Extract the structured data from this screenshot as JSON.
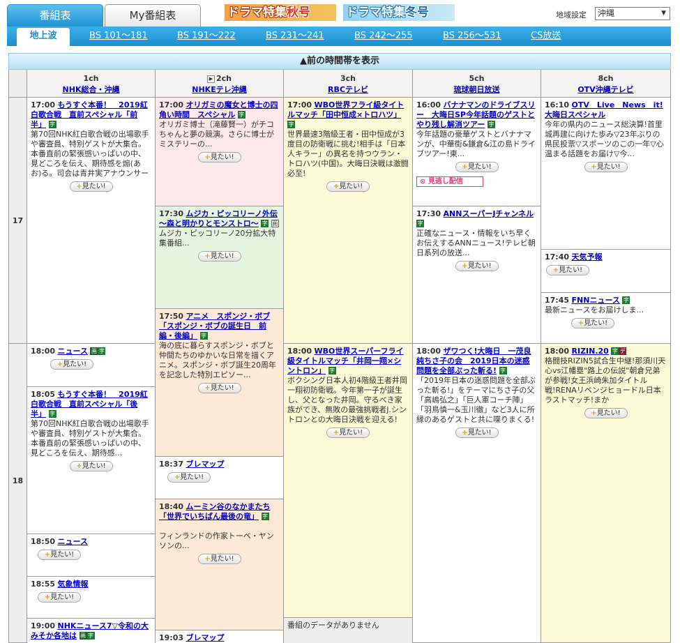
{
  "tabs": {
    "program_guide": "番組表",
    "my_guide": "My番組表"
  },
  "banners": {
    "aki": {
      "prefix": "ドラマ特集",
      "accent": "秋号"
    },
    "fuyu": {
      "prefix": "ドラマ特集",
      "accent": "冬号"
    }
  },
  "region": {
    "label": "地域設定",
    "value": "沖縄"
  },
  "bands": [
    "地上波",
    "BS 101～181",
    "BS 191～222",
    "BS 231～241",
    "BS 242～255",
    "BS 256～531",
    "CS放送"
  ],
  "prev_label": "▲前の時間帯を表示",
  "want_label": "見たい!",
  "miss_label": "見逃し配信",
  "hours": [
    "17",
    "18"
  ],
  "channels": [
    {
      "num": "1ch",
      "name": "NHK総合・沖縄"
    },
    {
      "num": "2ch",
      "name": "NHKEテレ沖縄",
      "play": "▶"
    },
    {
      "num": "3ch",
      "name": "RBCテレビ"
    },
    {
      "num": "5ch",
      "name": "琉球朝日放送"
    },
    {
      "num": "8ch",
      "name": "OTV沖縄テレビ"
    }
  ],
  "programs": {
    "c1p1": {
      "time": "17:00",
      "title": "もうすぐ本番！　2019紅白歌合戦　直前スペシャル「前半」",
      "desc": "第70回NHK紅白歌合戦の出場歌手や審査員、特別ゲストが大集合。本番直前の緊張感いっぱいの中、見どころを伝え、期待感を煽(あお)る。司会は青井実アナウンサー"
    },
    "c1p2": {
      "time": "18:00",
      "title": "ニュース",
      "desc": ""
    },
    "c1p3": {
      "time": "18:05",
      "title": "もうすぐ本番！　2019紅白歌合戦　直前スペシャル「後半」",
      "desc": "第70回NHK紅白歌合戦の出場歌手や審査員、特別ゲストが大集合。本番直前の緊張感いっぱいの中、見どころを伝え、期待感..."
    },
    "c1p4": {
      "time": "18:50",
      "title": "ニュース",
      "desc": ""
    },
    "c1p5": {
      "time": "18:55",
      "title": "気象情報",
      "desc": ""
    },
    "c1p6": {
      "time": "19:00",
      "title": "NHKニュース7▽令和の大みそか各地は",
      "desc": ""
    },
    "c2p1": {
      "time": "17:00",
      "title": "オリガミの魔女と博士の四角い時間　スペシャル",
      "desc": "オリガミ博士（滝藤賢一）がチコちゃんと夢の競演。さらに博士がミステリーの..."
    },
    "c2p2": {
      "time": "17:30",
      "title": "ムジカ・ピッコリーノ外伝～森と明かりとモンストロ～",
      "desc": "ムジカ・ピッコリーノ20分拡大特集番組..."
    },
    "c2p3": {
      "time": "17:50",
      "title": "アニメ　スポンジ・ボブ「スポンジ・ボブの誕生日　前編・後編」",
      "desc": "海の底に暮らすスポンジ・ボブと仲間たちのゆかいな日常を描くアニメ。スポンジ・ボブ誕生20周年を記念した特別エピソー..."
    },
    "c2p4": {
      "time": "18:37",
      "title": "ブレマップ",
      "desc": ""
    },
    "c2p5": {
      "time": "18:40",
      "title": "ムーミン谷のなかまたち「世界でいちばん最後の竜」",
      "desc": "フィンランドの作家トーベ・ヤンソンの..."
    },
    "c2p6": {
      "time": "19:03",
      "title": "ブレマップ",
      "desc": ""
    },
    "c3p1": {
      "time": "17:00",
      "title": "WBO世界フライ級タイトルマッチ「田中恒成×トロハツ」",
      "desc": "世界最速3階級王者・田中恒成が3度目の防衛戦に挑む!相手は「日本人キラー」の異名を持つウラン・トロハツ(中国)。大晦日決戦は激闘必至!"
    },
    "c3p2": {
      "time": "18:00",
      "title": "WBO世界スーパーフライ級タイトルマッチ「井岡一翔×シントロン」",
      "desc": "ボクシング日本人初4階級王者井岡一翔初防衛戦。今年第一子が誕生し、父となった井岡。守るべき家族ができ、無敗の最強挑戦者J.シントロンとの大晦日決戦を迎える!"
    },
    "c3p3": {
      "desc": "番組のデータがありません"
    },
    "c5p1": {
      "time": "16:00",
      "title": "バナナマンのドライブスリー　大晦日SP今年話題のゲストとやり残し解消ツアー",
      "desc": "今年話題の豪華ゲストとバナナマンが、中華街&鎌倉&江の島ドライブツアー!東..."
    },
    "c5p2": {
      "time": "17:30",
      "title": "ANNスーパーJチャンネル",
      "desc": "正確なニュース・情報をいち早くお伝えするANNニュース!テレビ朝日系列の放送..."
    },
    "c5p3": {
      "time": "18:00",
      "title": "ザワつく!大晦日　一茂良純ちさ子の会　2019日本の迷惑問題を全部ぶった斬る!",
      "desc": "「2019年日本の迷惑問題を全部ぶった斬る!」をテーマにちさ子の父「高嶋弘之」「巨人軍コーチ陣」「羽鳥慎一&玉川徹」など3人に所縁のあるゲストと共に喋りまくる!"
    },
    "c8p1": {
      "time": "16:10",
      "title": "OTV　Live　News　it!大晦日スペシャル",
      "desc": "今年の県内のニュース総決算!首里城再建に向けた歩み▽23年ぶりの県民投票▽スポーツのこの一年▽心温まる話題をお届け▽今..."
    },
    "c8p2": {
      "time": "17:40",
      "title": "天気予報",
      "desc": ""
    },
    "c8p3": {
      "time": "17:45",
      "title": "FNNニュース",
      "desc": "最新ニュースをお届けしま..."
    },
    "c8p4": {
      "time": "18:00",
      "title": "RIZIN.20",
      "desc": "格闘技RIZIN5試合生中継!那須川天心vs江幡塁\"路上の伝説\"朝倉兄弟が参戦!女王浜崎朱加タイトル戦!RENAリベンジヒョードル日本ラストマッチ!まか"
    }
  },
  "badges": {
    "ji": "字",
    "deco": "デ",
    "han": "画"
  },
  "colors": {
    "accent_blue": "#1b8fd0",
    "link": "#0000cc",
    "pink": "#fde8ec",
    "green": "#e6f5dd",
    "orange": "#fde9d6",
    "yellow": "#fcf9d6"
  }
}
